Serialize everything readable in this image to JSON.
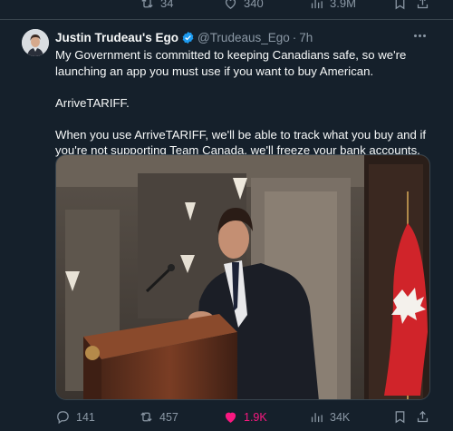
{
  "top_actions": {
    "retweets": "34",
    "likes": "340",
    "views": "3.9M"
  },
  "tweet": {
    "author_name": "Justin Trudeau's Ego",
    "handle": "@Trudeaus_Ego",
    "separator": "·",
    "time": "7h",
    "paragraphs": [
      "My Government is committed to keeping Canadians safe, so we're launching an app you must use if you want to buy American.",
      "ArriveTARIFF.",
      "When you use ArriveTARIFF, we'll be able to track what you buy and if you're not supporting Team Canada, we'll freeze your bank accounts."
    ]
  },
  "actions": {
    "replies": "141",
    "retweets": "457",
    "likes": "1.9K",
    "views": "34K"
  },
  "colors": {
    "background": "#15202b",
    "text": "#f7f9f9",
    "muted": "#8b98a5",
    "verified": "#1d9bf0",
    "like": "#f91880"
  },
  "icons": [
    "retweet-icon",
    "heart-icon",
    "views-icon",
    "bookmark-icon",
    "share-icon",
    "reply-icon",
    "verified-icon",
    "more-icon"
  ]
}
